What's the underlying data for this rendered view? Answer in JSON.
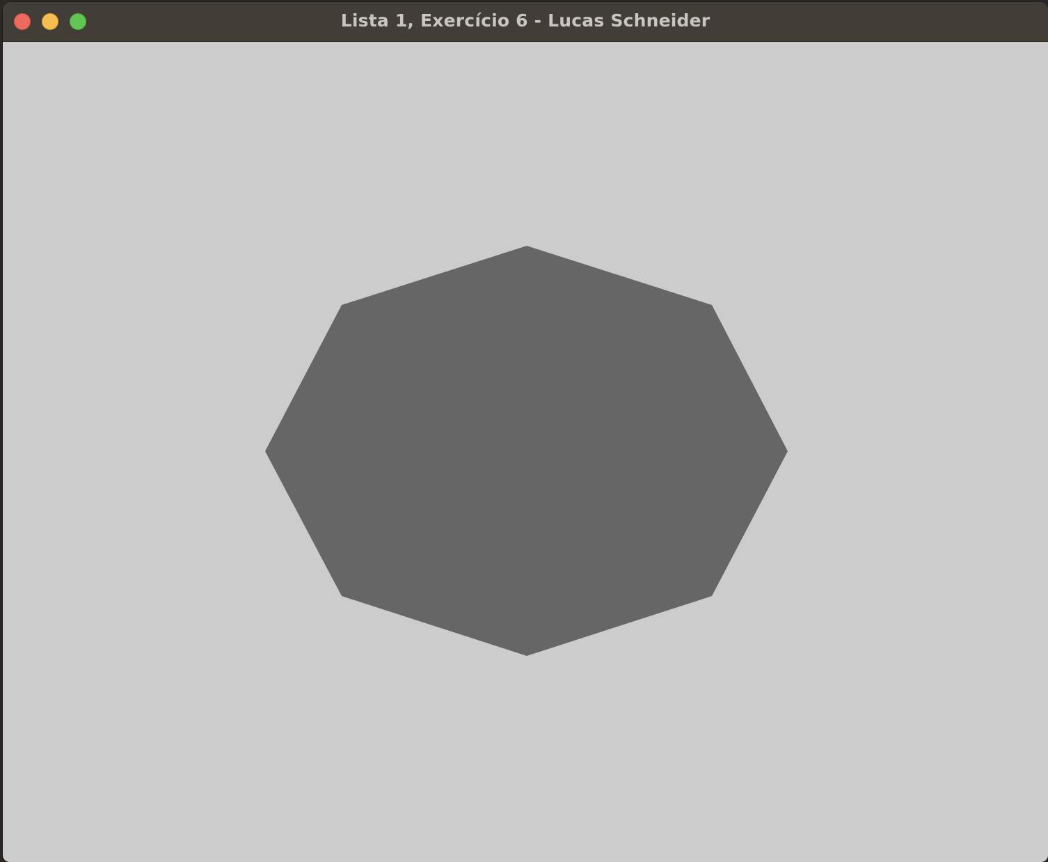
{
  "window": {
    "title": "Lista 1, Exercício 6 - Lucas Schneider"
  },
  "colors": {
    "titlebar": "#433d38",
    "canvas_background": "#cccccc",
    "polygon_fill": "#666666",
    "close_button": "#ed6a5e",
    "minimize_button": "#f5bf4f",
    "zoom_button": "#61c554"
  },
  "canvas": {
    "shape": "octagon"
  }
}
